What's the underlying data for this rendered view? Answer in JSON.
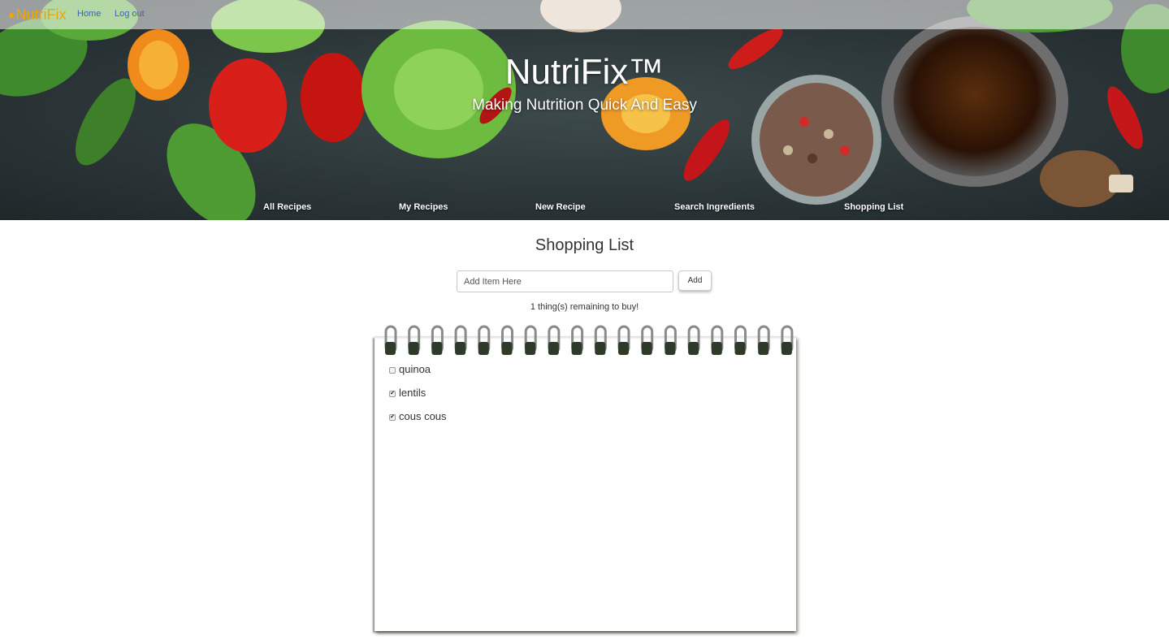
{
  "brand": {
    "logo_text": "NutriFix",
    "hat_icon": "chef-hat-icon",
    "color": "#f0a500"
  },
  "topnav": {
    "home": "Home",
    "logout": "Log out"
  },
  "hero": {
    "title": "NutriFix™",
    "subtitle": "Making Nutrition Quick And Easy",
    "menu": [
      "All Recipes",
      "My Recipes",
      "New Recipe",
      "Search Ingredients",
      "Shopping List"
    ]
  },
  "main": {
    "title": "Shopping List",
    "input": {
      "placeholder": "Add Item Here",
      "value": ""
    },
    "add_label": "Add",
    "remaining": "1 thing(s) remaining to buy!"
  },
  "list": {
    "items": [
      {
        "label": "quinoa",
        "checked": false
      },
      {
        "label": "lentils",
        "checked": true
      },
      {
        "label": "cous cous",
        "checked": true
      }
    ]
  },
  "colors": {
    "link": "#3a63b6",
    "accent": "#f0a500"
  }
}
